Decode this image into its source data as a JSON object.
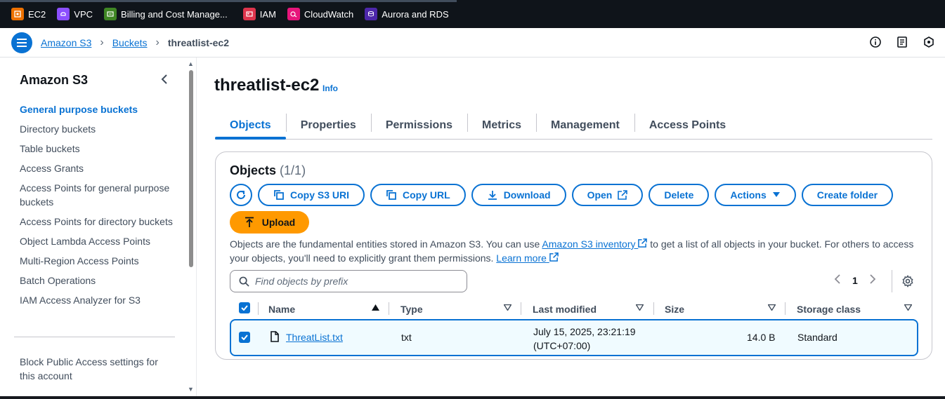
{
  "favorites": [
    {
      "label": "EC2",
      "icon": "ec2-icon",
      "color": "#ed7100"
    },
    {
      "label": "VPC",
      "icon": "vpc-icon",
      "color": "#8c4fff"
    },
    {
      "label": "Billing and Cost Manage...",
      "icon": "billing-icon",
      "color": "#3f8624"
    },
    {
      "label": "IAM",
      "icon": "iam-icon",
      "color": "#dd344c"
    },
    {
      "label": "CloudWatch",
      "icon": "cloudwatch-icon",
      "color": "#e7157b"
    },
    {
      "label": "Aurora and RDS",
      "icon": "rds-icon",
      "color": "#4d27aa"
    }
  ],
  "breadcrumb": {
    "items": [
      "Amazon S3",
      "Buckets"
    ],
    "current": "threatlist-ec2"
  },
  "sidenav": {
    "title": "Amazon S3",
    "items": [
      "General purpose buckets",
      "Directory buckets",
      "Table buckets",
      "Access Grants",
      "Access Points for general purpose buckets",
      "Access Points for directory buckets",
      "Object Lambda Access Points",
      "Multi-Region Access Points",
      "Batch Operations",
      "IAM Access Analyzer for S3"
    ],
    "bottom": "Block Public Access settings for this account"
  },
  "page": {
    "title": "threatlist-ec2",
    "info": "Info",
    "tabs": [
      "Objects",
      "Properties",
      "Permissions",
      "Metrics",
      "Management",
      "Access Points"
    ]
  },
  "objects_panel": {
    "title": "Objects",
    "count": "(1/1)",
    "buttons": {
      "copy_uri": "Copy S3 URI",
      "copy_url": "Copy URL",
      "download": "Download",
      "open": "Open",
      "delete": "Delete",
      "actions": "Actions",
      "create_folder": "Create folder",
      "upload": "Upload"
    },
    "desc_part1": "Objects are the fundamental entities stored in Amazon S3. You can use ",
    "desc_link1": "Amazon S3 inventory",
    "desc_part2": " to get a list of all objects in your bucket. For others to access your objects, you'll need to explicitly grant them permissions. ",
    "desc_link2": "Learn more",
    "search_placeholder": "Find objects by prefix",
    "page_number": "1",
    "columns": [
      "Name",
      "Type",
      "Last modified",
      "Size",
      "Storage class"
    ],
    "rows": [
      {
        "name": "ThreatList.txt",
        "type": "txt",
        "modified_line1": "July 15, 2025, 23:21:19",
        "modified_line2": "(UTC+07:00)",
        "size": "14.0 B",
        "storage": "Standard"
      }
    ]
  },
  "colors": {
    "accent": "#0972d3",
    "upload": "#ff9900",
    "dark": "#0f141a"
  }
}
